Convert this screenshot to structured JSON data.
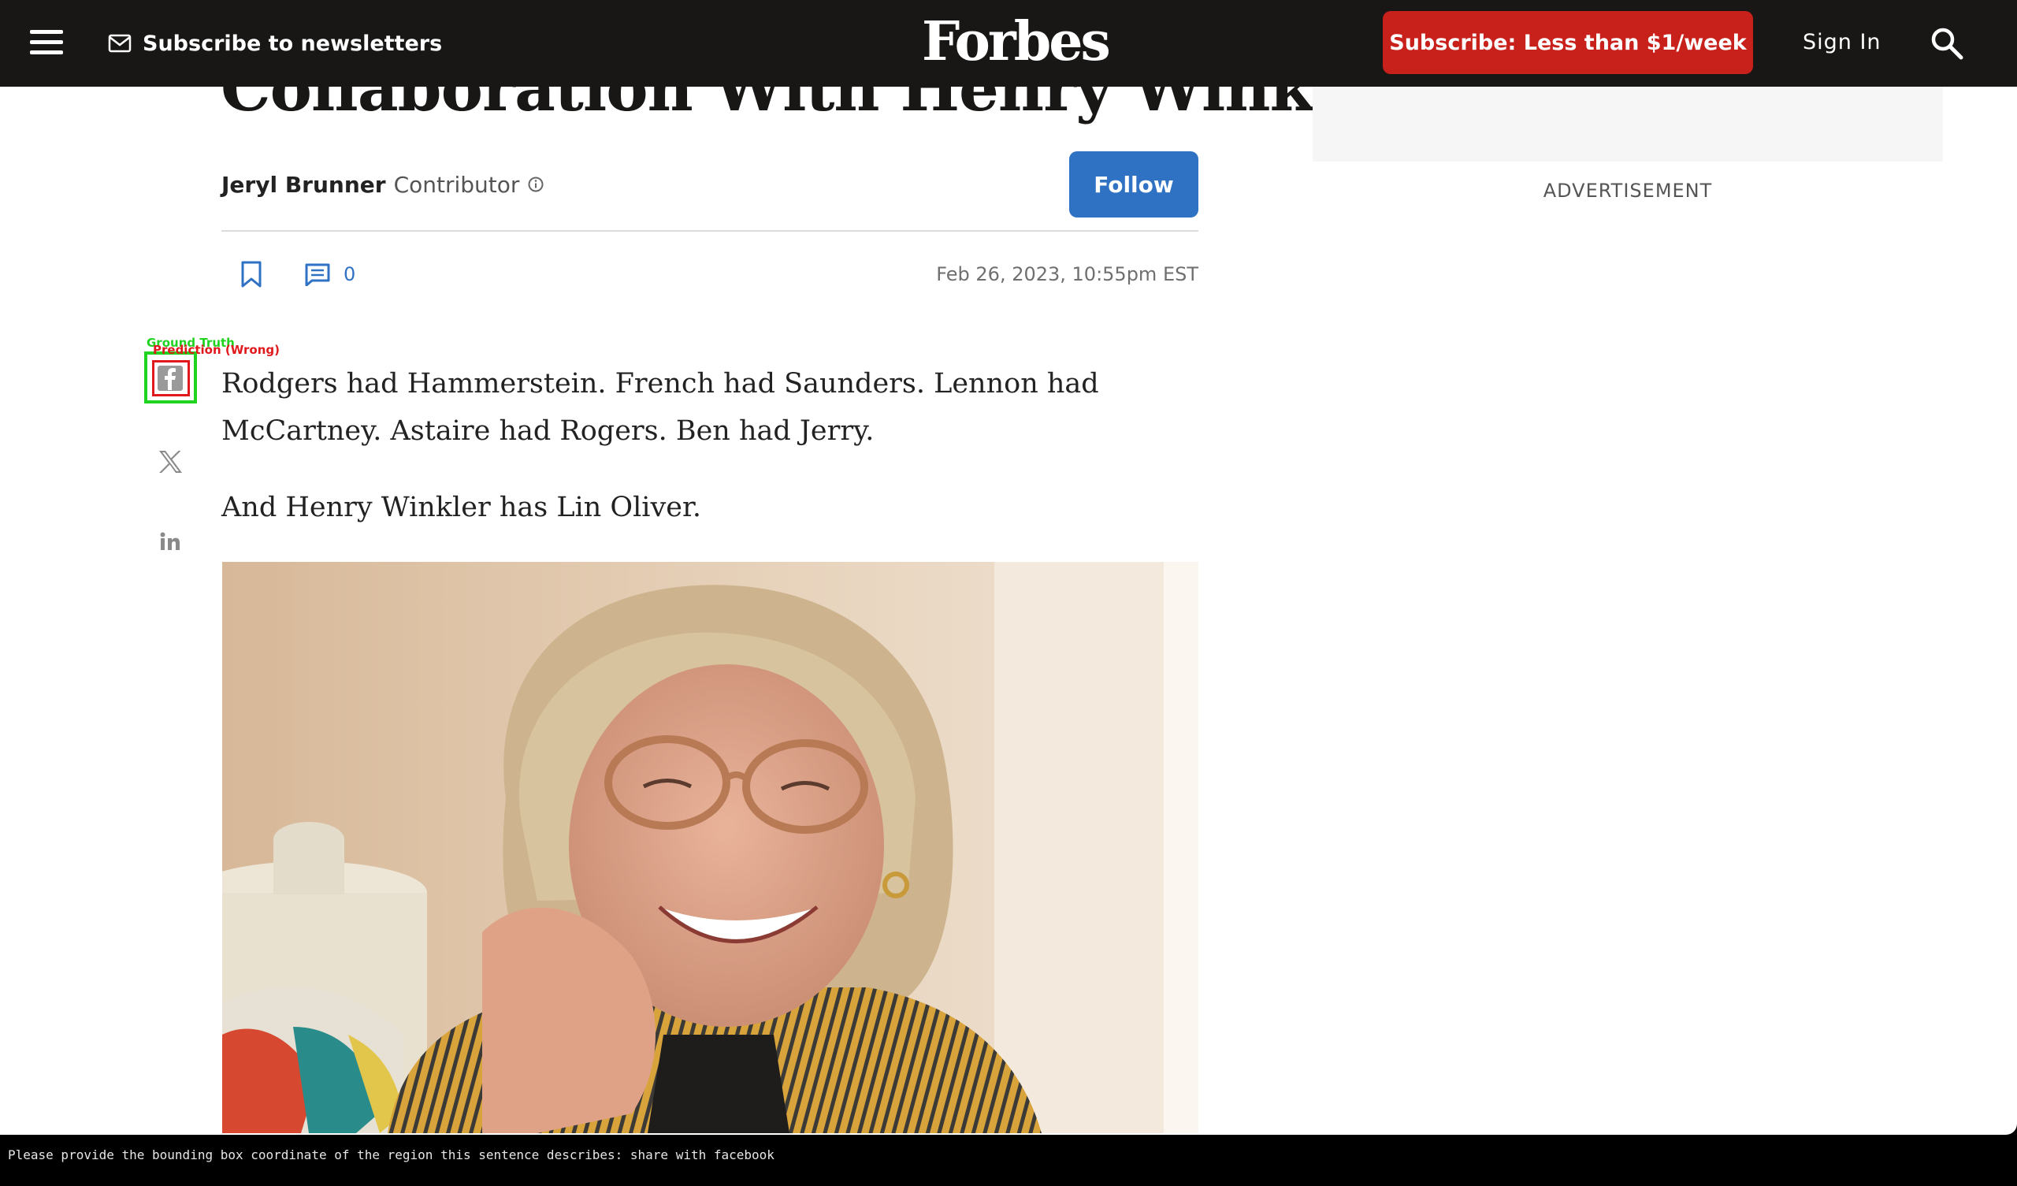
{
  "nav": {
    "newsletter_label": "Subscribe to newsletters",
    "logo": "Forbes",
    "subscribe_label": "Subscribe: Less than $1/week",
    "signin_label": "Sign In"
  },
  "article": {
    "headline_fragment": "Collaboration With Henry Winkler",
    "author": "Jeryl Brunner",
    "author_role": "Contributor",
    "follow_label": "Follow",
    "comment_count": "0",
    "timestamp": "Feb 26, 2023, 10:55pm EST",
    "paragraphs": [
      "Rodgers had Hammerstein. French had Saunders. Lennon had McCartney. Astaire had Rogers. Ben had Jerry.",
      "And Henry Winkler has Lin Oliver."
    ]
  },
  "share": {
    "icons": [
      "facebook-icon",
      "x-icon",
      "linkedin-icon"
    ]
  },
  "sidebar": {
    "ad_label": "ADVERTISEMENT"
  },
  "annotation": {
    "ground_truth_label": "Ground Truth",
    "prediction_label": "Prediction (Wrong)",
    "instruction": "Please provide the bounding box coordinate of the region this sentence describes: share with facebook"
  },
  "colors": {
    "nav_bg": "#181716",
    "subscribe_bg": "#c8201b",
    "follow_bg": "#2f72c4",
    "ground_truth": "#1fd31f",
    "prediction": "#e0191c"
  }
}
